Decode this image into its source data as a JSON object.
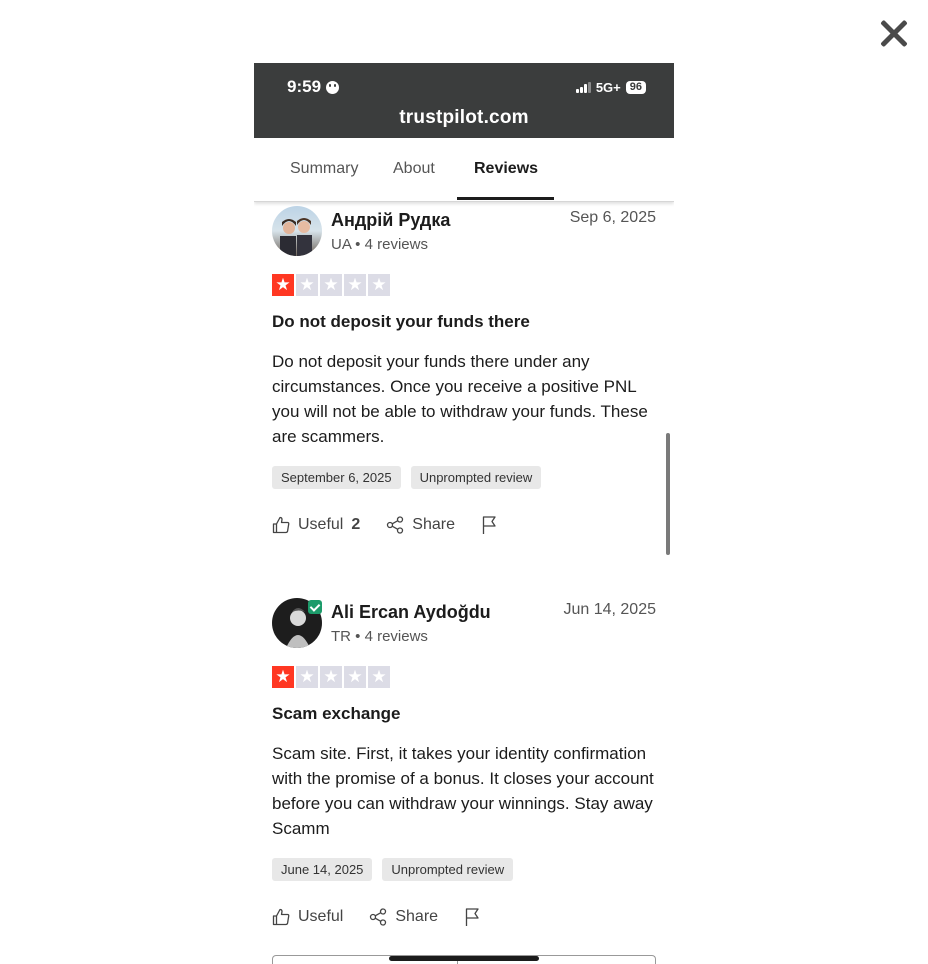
{
  "status_bar": {
    "time": "9:59",
    "network": "5G+",
    "battery": "96",
    "url": "trustpilot.com"
  },
  "tabs": [
    {
      "label": "Summary"
    },
    {
      "label": "About"
    },
    {
      "label": "Reviews",
      "active": true
    }
  ],
  "reviews": [
    {
      "author": "Андрій Рудка",
      "meta": "UA • 4 reviews",
      "date": "Sep 6, 2025",
      "rating": 1,
      "title": "Do not deposit your funds there",
      "body": "Do not deposit your funds there under any circumstances. Once you receive a positive PNL you will not be able to withdraw your funds. These are scammers.",
      "experience_date": "September 6, 2025",
      "review_type": "Unprompted review",
      "useful_label": "Useful",
      "useful_count": "2",
      "share_label": "Share"
    },
    {
      "author": "Ali Ercan Aydoğdu",
      "meta": "TR • 4 reviews",
      "date": "Jun 14, 2025",
      "rating": 1,
      "title": "Scam exchange",
      "body": "Scam site. First, it takes your identity confirmation with the promise of a bonus. It closes your account before you can withdraw your winnings. Stay away Scamm",
      "experience_date": "June 14, 2025",
      "review_type": "Unprompted review",
      "useful_label": "Useful",
      "share_label": "Share",
      "verified": true
    }
  ],
  "colors": {
    "star_active": "#ff3722",
    "star_inactive": "#dcdce6",
    "status_bar_bg": "#3b3d3d",
    "verified": "#1c9b6a"
  }
}
